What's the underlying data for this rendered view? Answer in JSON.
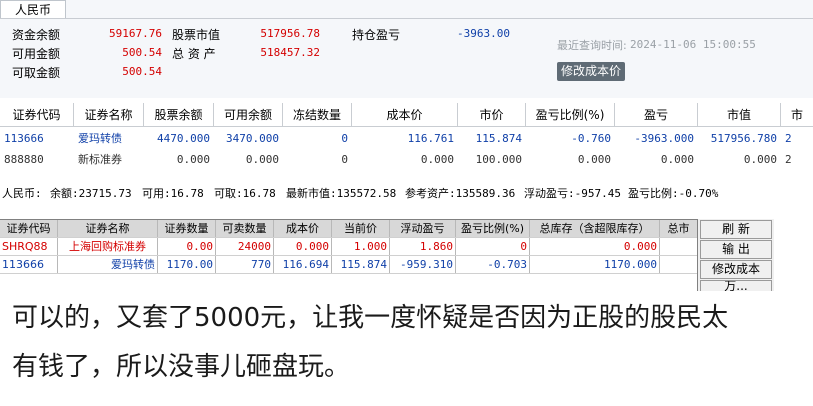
{
  "panel1": {
    "tab": "人民币",
    "summary": {
      "cash_balance_label": "资金余额",
      "cash_balance": "59167.76",
      "available_label": "可用金额",
      "available": "500.54",
      "withdrawable_label": "可取金额",
      "withdrawable": "500.54",
      "stock_value_label": "股票市值",
      "stock_value": "517956.78",
      "total_assets_label": "总 资 产",
      "total_assets": "518457.32",
      "position_pnl_label": "持仓盈亏",
      "position_pnl": "-3963.00",
      "last_query_label": "最近查询时间:",
      "last_query_time": "2024-11-06 15:00:55",
      "edit_cost_button": "修改成本价"
    },
    "table": {
      "columns": [
        "证券代码",
        "证券名称",
        "股票余额",
        "可用余额",
        "冻结数量",
        "成本价",
        "市价",
        "盈亏比例(%)",
        "盈亏",
        "市值",
        "市"
      ],
      "rows": [
        [
          "113666",
          "爱玛转债",
          "4470.000",
          "3470.000",
          "0",
          "116.761",
          "115.874",
          "-0.760",
          "-3963.000",
          "517956.780",
          "2"
        ],
        [
          "888880",
          "新标准券",
          "0.000",
          "0.000",
          "0",
          "0.000",
          "100.000",
          "0.000",
          "0.000",
          "0.000",
          "2"
        ]
      ]
    }
  },
  "panel2": {
    "status": {
      "currency": "人民币:",
      "balance": "余额:23715.73",
      "available": "可用:16.78",
      "withdrawable": "可取:16.78",
      "latest_value": "最新市值:135572.58",
      "ref_assets": "参考资产:135589.36",
      "floating_pnl": "浮动盈亏:-957.45",
      "pnl_ratio": "盈亏比例:-0.70%"
    },
    "table": {
      "columns": [
        "证券代码",
        "证券名称",
        "证券数量",
        "可卖数量",
        "成本价",
        "当前价",
        "浮动盈亏",
        "盈亏比例(%)",
        "总库存（含超限库存）",
        "总市"
      ],
      "rows": [
        [
          "SHRQ88",
          "上海回购标准券",
          "0.00",
          "24000",
          "0.000",
          "1.000",
          "1.860",
          "0",
          "0.000",
          ""
        ],
        [
          "113666",
          "爱玛转债",
          "1170.00",
          "770",
          "116.694",
          "115.874",
          "-959.310",
          "-0.703",
          "1170.000",
          ""
        ]
      ]
    },
    "buttons": {
      "refresh": "刷 新",
      "export": "输 出",
      "edit_cost": "修改成本",
      "more": "万..."
    }
  },
  "caption": {
    "line1": "可以的，又套了5000元，让我一度怀疑是否因为正股的股民太",
    "line2": "有钱了，所以没事儿砸盘玩。"
  },
  "colors": {
    "red": "#d40000",
    "blue": "#1040a8",
    "panel_bg": "#f5f7fa",
    "button_dark": "#5f6b75"
  }
}
